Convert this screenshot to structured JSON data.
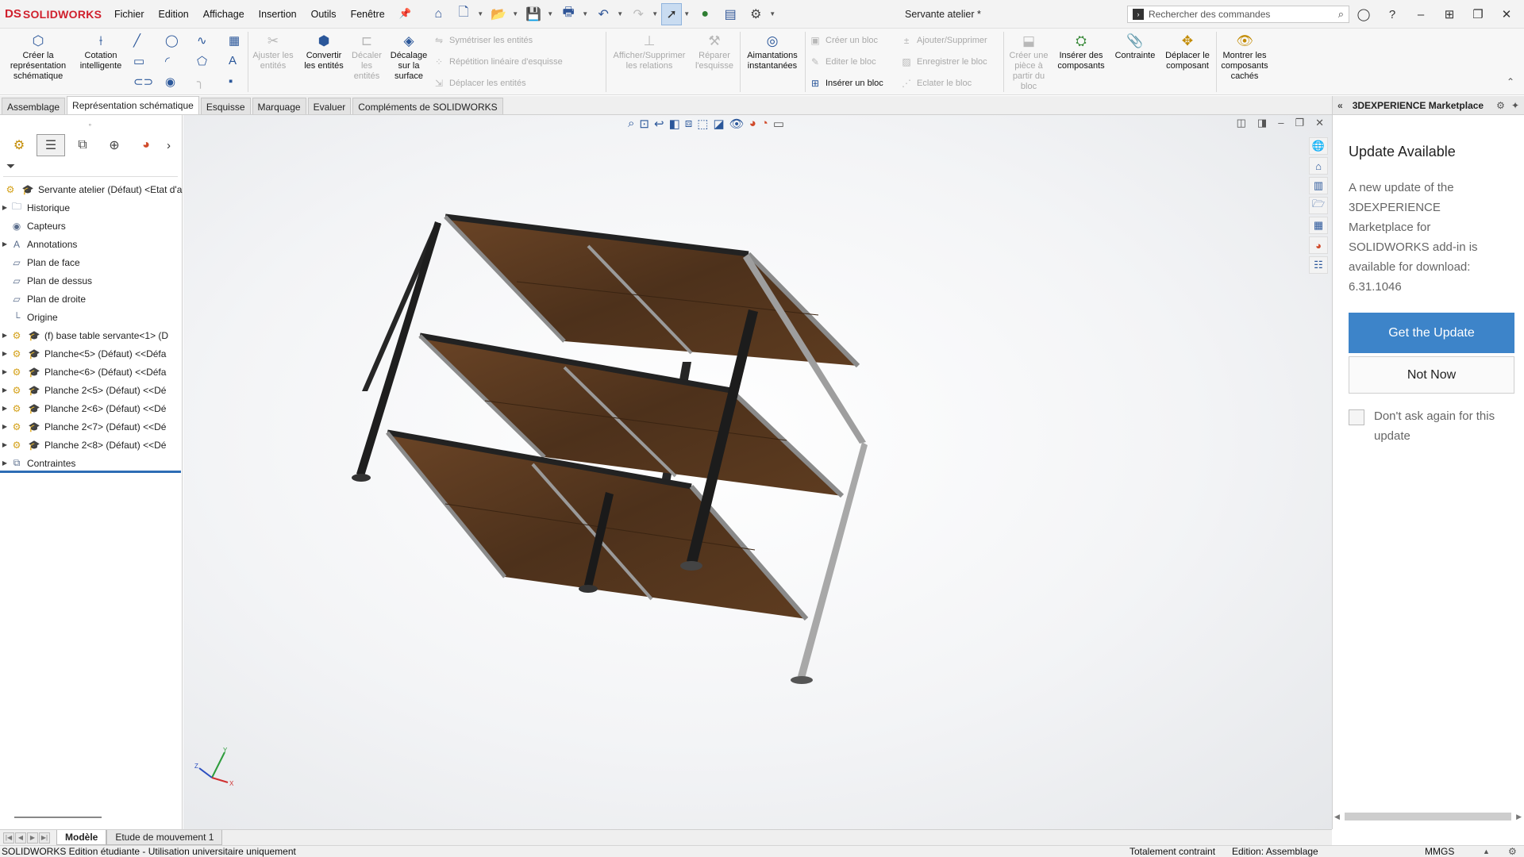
{
  "app": {
    "logo_ds": "DS",
    "logo_name": "SOLIDWORKS",
    "doc_title": "Servante atelier *"
  },
  "menu": [
    "Fichier",
    "Edition",
    "Affichage",
    "Insertion",
    "Outils",
    "Fenêtre"
  ],
  "search": {
    "placeholder": "Rechercher des commandes"
  },
  "ribbon": {
    "creer_representation": "Créer la représentation schématique",
    "cotation": "Cotation intelligente",
    "ajuster": "Ajuster les entités",
    "convertir": "Convertir les entités",
    "decaler": "Décaler les entités",
    "decalage_surface": "Décalage sur la surface",
    "symetriser": "Symétriser les entités",
    "repetition": "Répétition linéaire d'esquisse",
    "deplacer_entites": "Déplacer les entités",
    "afficher_relations": "Afficher/Supprimer les relations",
    "reparer": "Réparer l'esquisse",
    "aimantations": "Aimantations instantanées",
    "creer_bloc": "Créer un bloc",
    "editer_bloc": "Editer le bloc",
    "inserer_bloc": "Insérer un bloc",
    "ajouter_supprimer": "Ajouter/Supprimer",
    "enregistrer_bloc": "Enregistrer le bloc",
    "eclater_bloc": "Eclater le bloc",
    "creer_piece": "Créer une pièce à partir du bloc",
    "inserer_composants": "Insérer des composants",
    "contrainte": "Contrainte",
    "deplacer_composant": "Déplacer le composant",
    "montrer_caches": "Montrer les composants cachés"
  },
  "cmd_tabs": [
    "Assemblage",
    "Représentation schématique",
    "Esquisse",
    "Marquage",
    "Evaluer",
    "Compléments de SOLIDWORKS"
  ],
  "tree": {
    "root": "Servante atelier (Défaut) <Etat d'a",
    "items": [
      {
        "label": "Historique",
        "icon": "folder-icon",
        "expand": true
      },
      {
        "label": "Capteurs",
        "icon": "sensor-icon",
        "expand": false
      },
      {
        "label": "Annotations",
        "icon": "annotation-icon",
        "expand": true
      },
      {
        "label": "Plan de face",
        "icon": "plane-icon",
        "expand": false
      },
      {
        "label": "Plan de dessus",
        "icon": "plane-icon",
        "expand": false
      },
      {
        "label": "Plan de droite",
        "icon": "plane-icon",
        "expand": false
      },
      {
        "label": "Origine",
        "icon": "origin-icon",
        "expand": false
      },
      {
        "label": "(f) base table servante<1> (D",
        "icon": "part-icon",
        "expand": true
      },
      {
        "label": "Planche<5> (Défaut) <<Défa",
        "icon": "part-icon",
        "expand": true
      },
      {
        "label": "Planche<6> (Défaut) <<Défa",
        "icon": "part-icon",
        "expand": true
      },
      {
        "label": "Planche 2<5> (Défaut) <<Dé",
        "icon": "part-icon",
        "expand": true
      },
      {
        "label": "Planche 2<6> (Défaut) <<Dé",
        "icon": "part-icon",
        "expand": true
      },
      {
        "label": "Planche 2<7> (Défaut) <<Dé",
        "icon": "part-icon",
        "expand": true
      },
      {
        "label": "Planche 2<8> (Défaut) <<Dé",
        "icon": "part-icon",
        "expand": true
      },
      {
        "label": "Contraintes",
        "icon": "mates-icon",
        "expand": true
      }
    ]
  },
  "taskpane": {
    "title": "3DEXPERIENCE Marketplace",
    "update_title": "Update Available",
    "update_msg": "A new update of the 3DEXPERIENCE Marketplace for SOLIDWORKS add-in is available for download: 6.31.1046",
    "get_update": "Get the Update",
    "not_now": "Not Now",
    "dont_ask": "Don't ask again for this update"
  },
  "model_tabs": [
    "Modèle",
    "Etude de mouvement 1"
  ],
  "status": {
    "left": "SOLIDWORKS Edition étudiante - Utilisation universitaire uniquement",
    "constraint": "Totalement contraint",
    "edition": "Edition: Assemblage",
    "units": "MMGS"
  },
  "triad": {
    "x": "X",
    "y": "Y",
    "z": "Z"
  },
  "colors": {
    "accent": "#3d84c9",
    "brand": "#d0202d",
    "wood": "#5b3a1e",
    "steel": "#2b2b2b"
  }
}
